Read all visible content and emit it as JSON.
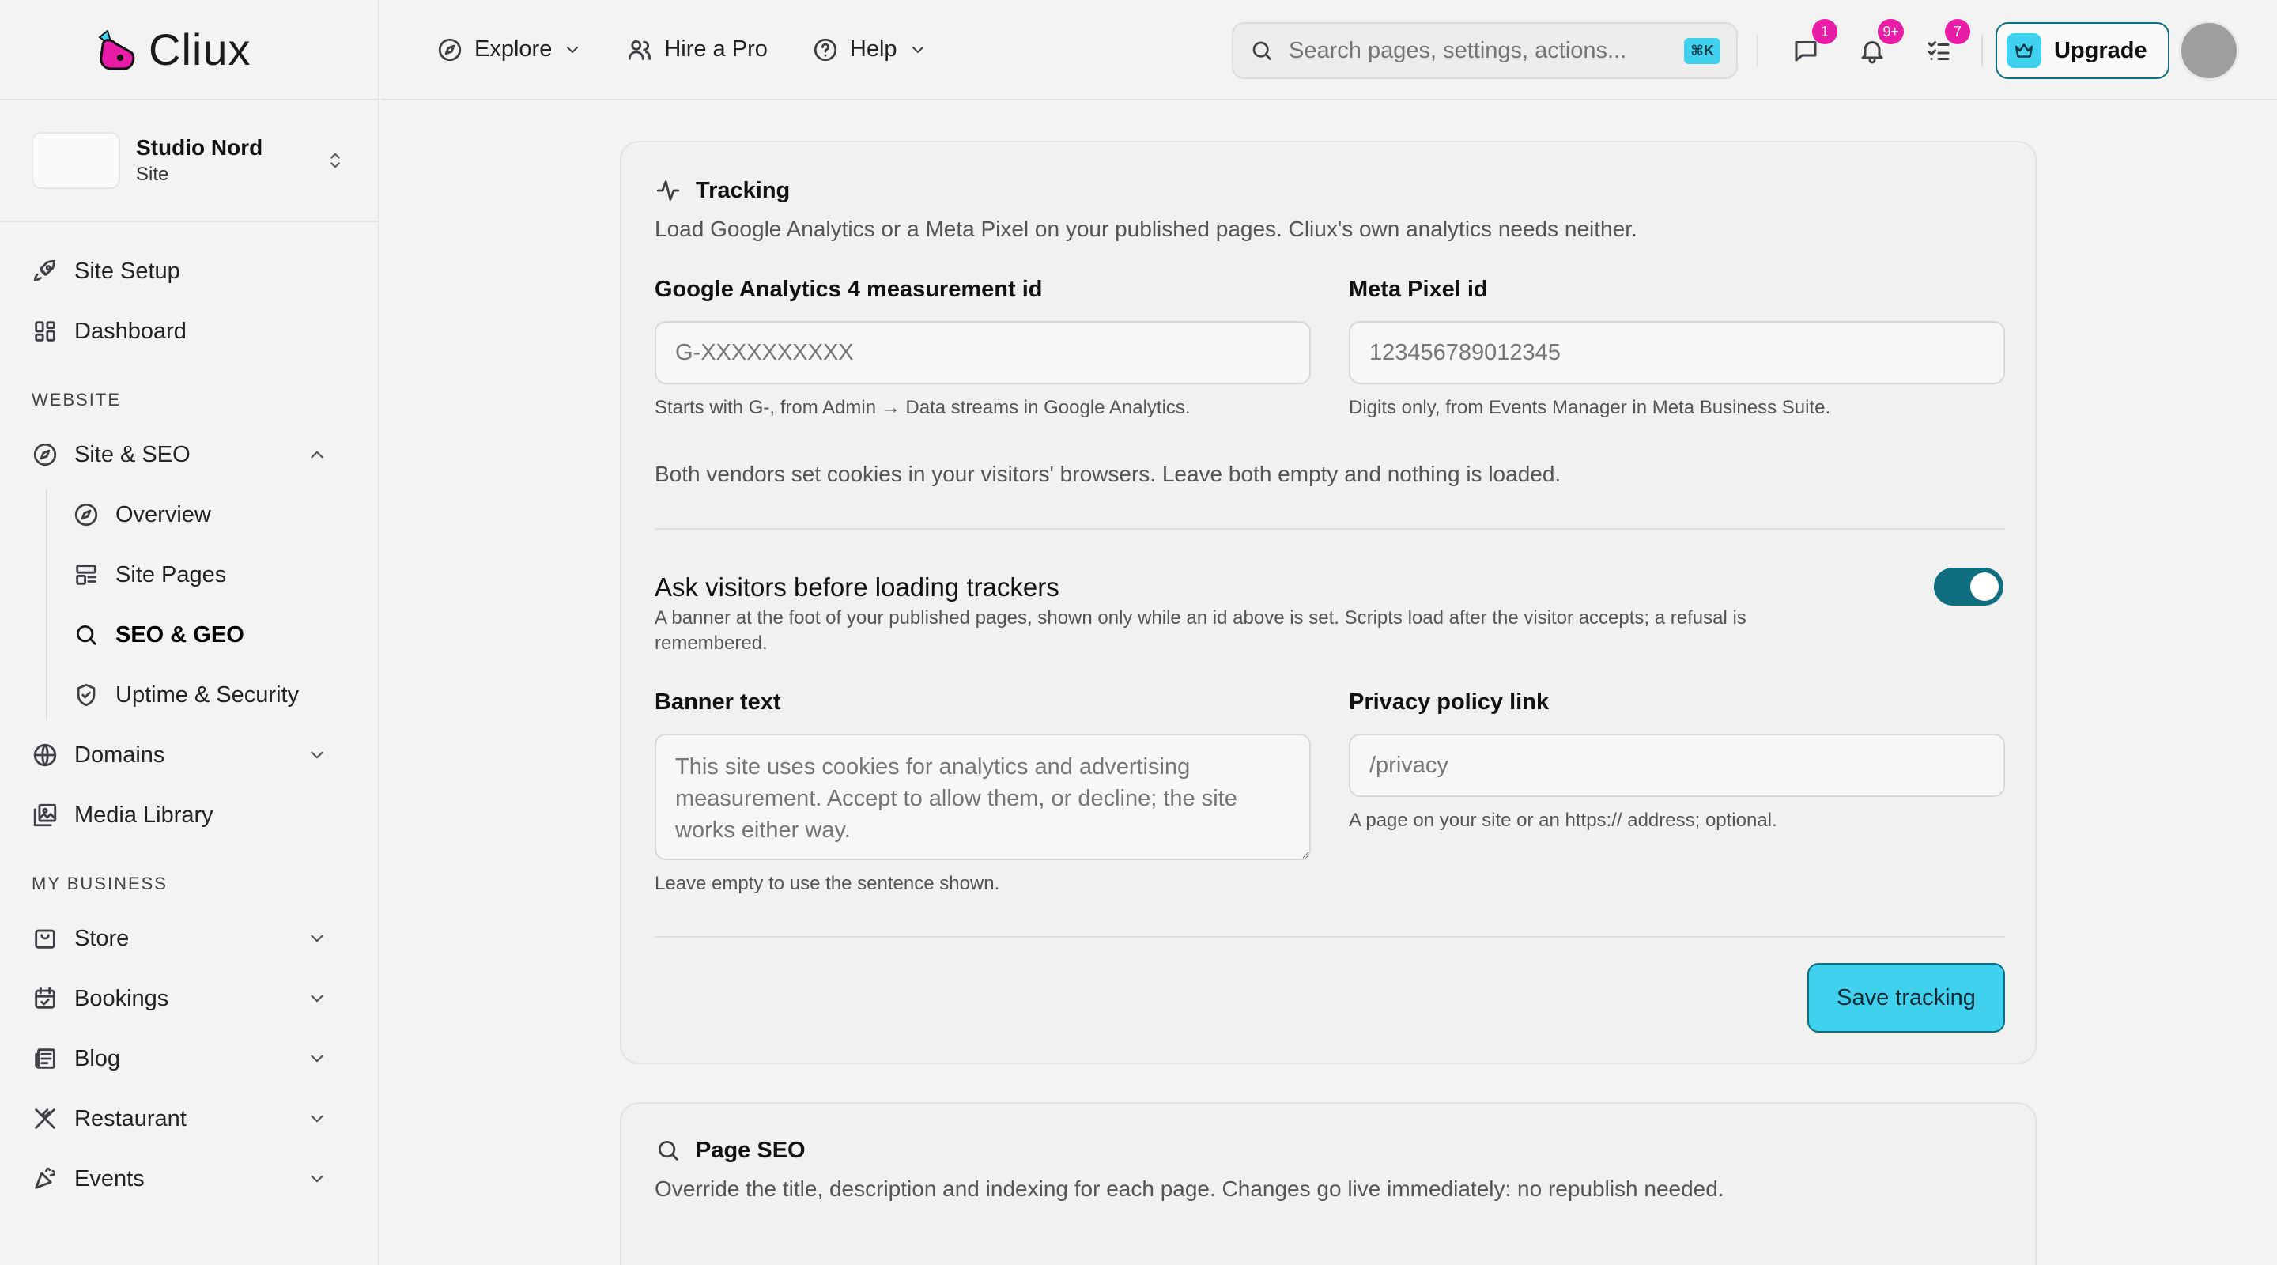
{
  "brand": {
    "name": "Cliux"
  },
  "site": {
    "name": "Studio Nord",
    "kind": "Site"
  },
  "sidebar": {
    "top_items": [
      {
        "label": "Site Setup",
        "icon": "rocket-icon"
      },
      {
        "label": "Dashboard",
        "icon": "dashboard-icon"
      }
    ],
    "section_website": "WEBSITE",
    "site_seo": {
      "label": "Site & SEO",
      "children": [
        {
          "label": "Overview"
        },
        {
          "label": "Site Pages"
        },
        {
          "label": "SEO & GEO",
          "active": true
        },
        {
          "label": "Uptime & Security"
        }
      ]
    },
    "domains": "Domains",
    "media_library": "Media Library",
    "section_business": "MY BUSINESS",
    "business_items": [
      {
        "label": "Store"
      },
      {
        "label": "Bookings"
      },
      {
        "label": "Blog"
      },
      {
        "label": "Restaurant"
      },
      {
        "label": "Events"
      }
    ]
  },
  "topbar": {
    "explore": "Explore",
    "hire": "Hire a Pro",
    "help": "Help",
    "search_placeholder": "Search pages, settings, actions...",
    "search_shortcut": "⌘K",
    "messages_badge": "1",
    "notifications_badge": "9+",
    "tasks_badge": "7",
    "upgrade": "Upgrade"
  },
  "tracking": {
    "title": "Tracking",
    "description": "Load Google Analytics or a Meta Pixel on your published pages. Cliux's own analytics needs neither.",
    "ga_label": "Google Analytics 4 measurement id",
    "ga_placeholder": "G-XXXXXXXXXX",
    "ga_hint": "Starts with G-, from Admin → Data streams in Google Analytics.",
    "meta_label": "Meta Pixel id",
    "meta_placeholder": "123456789012345",
    "meta_hint": "Digits only, from Events Manager in Meta Business Suite.",
    "cookie_note": "Both vendors set cookies in your visitors' browsers. Leave both empty and nothing is loaded.",
    "consent_title": "Ask visitors before loading trackers",
    "consent_desc": "A banner at the foot of your published pages, shown only while an id above is set. Scripts load after the visitor accepts; a refusal is remembered.",
    "consent_enabled": true,
    "banner_label": "Banner text",
    "banner_placeholder": "This site uses cookies for analytics and advertising measurement. Accept to allow them, or decline; the site works either way.",
    "banner_hint": "Leave empty to use the sentence shown.",
    "privacy_label": "Privacy policy link",
    "privacy_placeholder": "/privacy",
    "privacy_hint": "A page on your site or an https:// address; optional.",
    "save": "Save tracking"
  },
  "page_seo": {
    "title": "Page SEO",
    "description": "Override the title, description and indexing for each page. Changes go live immediately: no republish needed."
  },
  "colors": {
    "accent": "#3fd1ee",
    "accent_dark": "#0f6e80",
    "badge": "#e81ca6"
  }
}
